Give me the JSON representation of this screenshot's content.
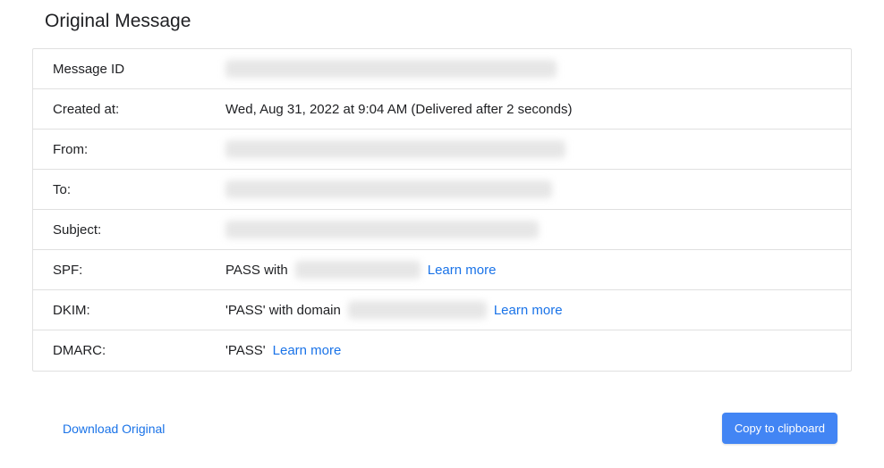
{
  "header": {
    "title": "Original Message"
  },
  "rows": {
    "message_id": {
      "label": "Message ID"
    },
    "created_at": {
      "label": "Created at:",
      "value": "Wed, Aug 31, 2022 at 9:04 AM (Delivered after 2 seconds)"
    },
    "from": {
      "label": "From:"
    },
    "to": {
      "label": "To:"
    },
    "subject": {
      "label": "Subject:"
    },
    "spf": {
      "label": "SPF:",
      "prefix": "PASS with",
      "learn_more": "Learn more"
    },
    "dkim": {
      "label": "DKIM:",
      "prefix": "'PASS' with domain",
      "learn_more": "Learn more"
    },
    "dmarc": {
      "label": "DMARC:",
      "prefix": "'PASS' ",
      "learn_more": "Learn more"
    }
  },
  "actions": {
    "download_original": "Download Original",
    "copy_to_clipboard": "Copy to clipboard"
  }
}
